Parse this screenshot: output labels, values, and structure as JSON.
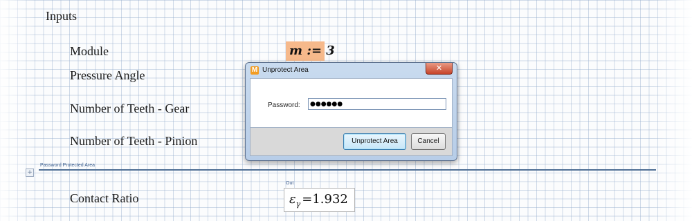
{
  "worksheet": {
    "section_title": "Inputs",
    "module_label": "Module",
    "module_expr": "m := 3",
    "pressure_angle_label": "Pressure Angle",
    "teeth_gear_label": "Number of Teeth - Gear",
    "teeth_pinion_label": "Number of Teeth - Pinion",
    "protected_area_label": "Password Protected Area",
    "contact_ratio_label": "Contact Ratio",
    "out_label": "Out",
    "result": {
      "symbol": "ε",
      "subscript": "γ",
      "equals": "=",
      "value": "1.932"
    },
    "highlight_color": "#f6b98b"
  },
  "dialog": {
    "title": "Unprotect Area",
    "app_icon_letter": "M",
    "close_glyph": "✕",
    "password_label": "Password:",
    "password_value": "●●●●●●",
    "unprotect_button": "Unprotect Area",
    "cancel_button": "Cancel",
    "close_color": "#c6442a"
  }
}
